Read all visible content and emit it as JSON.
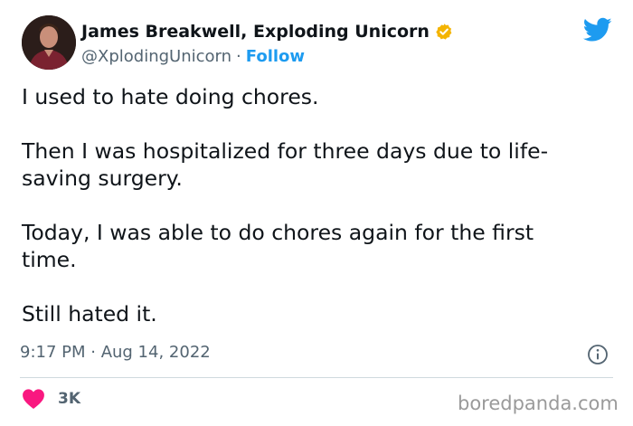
{
  "tweet": {
    "author": {
      "display_name": "James Breakwell, Exploding Unicorn",
      "handle": "@XplodingUnicorn",
      "separator": "·",
      "follow_label": "Follow",
      "verified_color": "#f4b400",
      "avatar_icon": "profile-photo"
    },
    "platform_icon": "twitter-bird-icon",
    "body": [
      "I used to hate doing chores.",
      "Then I was hospitalized for three days due to life-\nsaving surgery.",
      "Today, I was able to do chores again for the first\ntime.",
      "Still hated it."
    ],
    "timestamp": "9:17 PM · Aug 14, 2022",
    "likes": {
      "count": "3K",
      "icon": "heart-icon",
      "color": "#f91880"
    }
  },
  "watermark": "boredpanda.com",
  "colors": {
    "text": "#0f1419",
    "secondary": "#536471",
    "accent": "#1d9bf0",
    "divider": "#cfd9de"
  }
}
